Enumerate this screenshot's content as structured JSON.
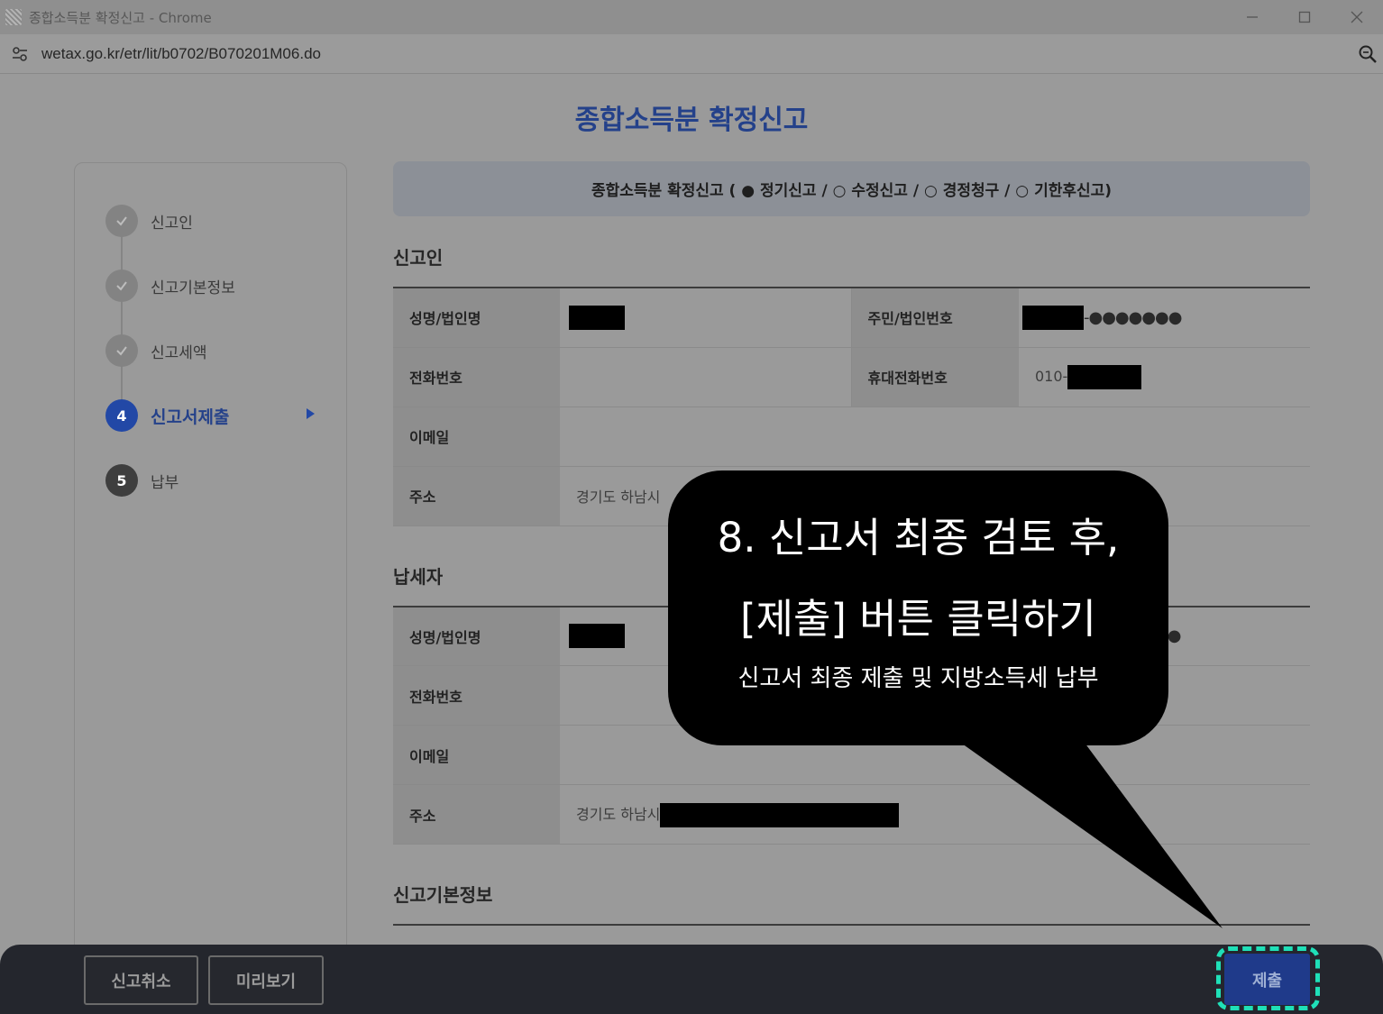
{
  "window": {
    "title": "종합소득분 확정신고 - Chrome",
    "url": "wetax.go.kr/etr/lit/b0702/B070201M06.do"
  },
  "page": {
    "title": "종합소득분 확정신고",
    "report_type": "종합소득분 확정신고 ( ● 정기신고 / ○ 수정신고 / ○ 경정청구 / ○ 기한후신고)"
  },
  "steps": [
    {
      "label": "신고인",
      "status": "done"
    },
    {
      "label": "신고기본정보",
      "status": "done"
    },
    {
      "label": "신고세액",
      "status": "done"
    },
    {
      "number": "4",
      "label": "신고서제출",
      "status": "active"
    },
    {
      "number": "5",
      "label": "납부",
      "status": "todo"
    }
  ],
  "filer": {
    "section_title": "신고인",
    "name_label": "성명/법인명",
    "id_label": "주민/법인번호",
    "id_masked": "-●●●●●●●",
    "phone_label": "전화번호",
    "mobile_label": "휴대전화번호",
    "mobile_prefix": "010-",
    "email_label": "이메일",
    "address_label": "주소",
    "address_value": "경기도 하남시"
  },
  "taxpayer": {
    "section_title": "납세자",
    "name_label": "성명/법인명",
    "id_masked": "●●",
    "phone_label": "전화번호",
    "email_label": "이메일",
    "address_label": "주소",
    "address_value": "경기도 하남시"
  },
  "basic_info": {
    "section_title": "신고기본정보"
  },
  "footer": {
    "cancel_label": "신고취소",
    "preview_label": "미리보기",
    "submit_label": "제출"
  },
  "callout": {
    "line1": "8. 신고서 최종 검토 후,",
    "line2": "[제출] 버튼 클릭하기",
    "sub": "신고서 최종 제출 및 지방소득세 납부"
  },
  "colors": {
    "accent": "#24418a",
    "submit_highlight": "#1fe0b8"
  }
}
